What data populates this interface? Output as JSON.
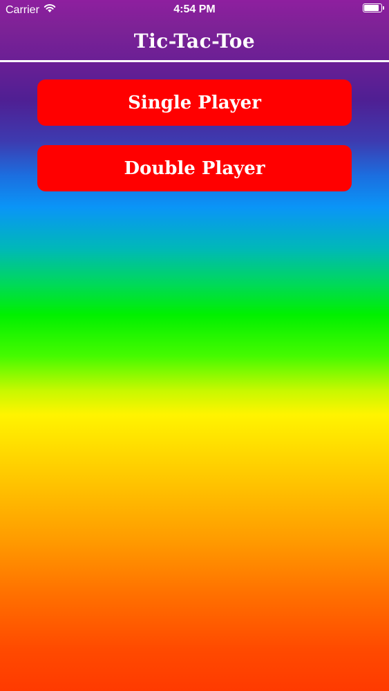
{
  "status_bar": {
    "carrier": "Carrier",
    "time": "4:54 PM",
    "wifi_icon": "wifi-icon",
    "battery_icon": "battery-icon",
    "battery_level": 0.9
  },
  "nav": {
    "title": "Tic-Tac-Toe"
  },
  "menu": {
    "single_player_label": "Single Player",
    "double_player_label": "Double Player"
  },
  "colors": {
    "button_red": "#ff0000",
    "text_white": "#ffffff",
    "gradient_top": "#8e1f9f",
    "gradient_bottom": "#ff3a00"
  }
}
